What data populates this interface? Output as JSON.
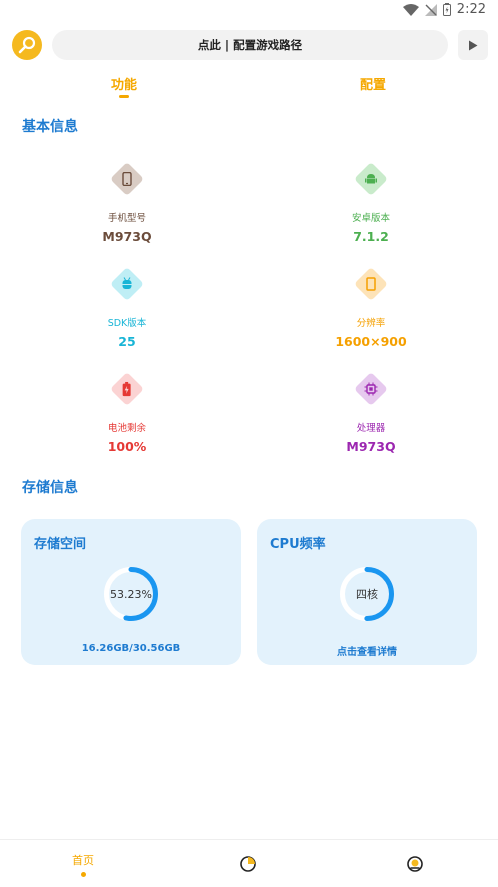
{
  "status_bar": {
    "time": "2:22"
  },
  "top_bar": {
    "path_hint": "点此 | 配置游戏路径"
  },
  "tabs": [
    {
      "label": "功能",
      "active": true
    },
    {
      "label": "配置",
      "active": false
    }
  ],
  "basic_info": {
    "title": "基本信息",
    "items": [
      {
        "label": "手机型号",
        "value": "M973Q",
        "color": "#6b4c3b",
        "bg": "#d9ccc4",
        "icon": "phone-icon"
      },
      {
        "label": "安卓版本",
        "value": "7.1.2",
        "color": "#4caf50",
        "bg": "#c9ebcb",
        "icon": "android-icon"
      },
      {
        "label": "SDK版本",
        "value": "25",
        "color": "#19b5d6",
        "bg": "#bfeef5",
        "icon": "sdk-robot-icon"
      },
      {
        "label": "分辨率",
        "value": "1600×900",
        "color": "#f5a000",
        "bg": "#fde3b8",
        "icon": "resolution-icon"
      },
      {
        "label": "电池剩余",
        "value": "100%",
        "color": "#e53935",
        "bg": "#fbd3d3",
        "icon": "battery-icon"
      },
      {
        "label": "处理器",
        "value": "M973Q",
        "color": "#9c27b0",
        "bg": "#e6c9ee",
        "icon": "cpu-chip-icon"
      }
    ]
  },
  "storage_info": {
    "title": "存储信息",
    "storage_card": {
      "title": "存储空间",
      "percent_text": "53.23%",
      "percent": 0.5323,
      "usage": "16.26GB/30.56GB"
    },
    "cpu_card": {
      "title": "CPU频率",
      "core_text": "四核",
      "fill": 0.5,
      "link": "点击查看详情"
    }
  },
  "bottom_nav": {
    "home_label": "首页"
  },
  "colors": {
    "accent": "#f5a800",
    "primary_blue": "#1e7bd0",
    "card_bg": "#e3f2fc",
    "ring_blue": "#1a96f0"
  }
}
